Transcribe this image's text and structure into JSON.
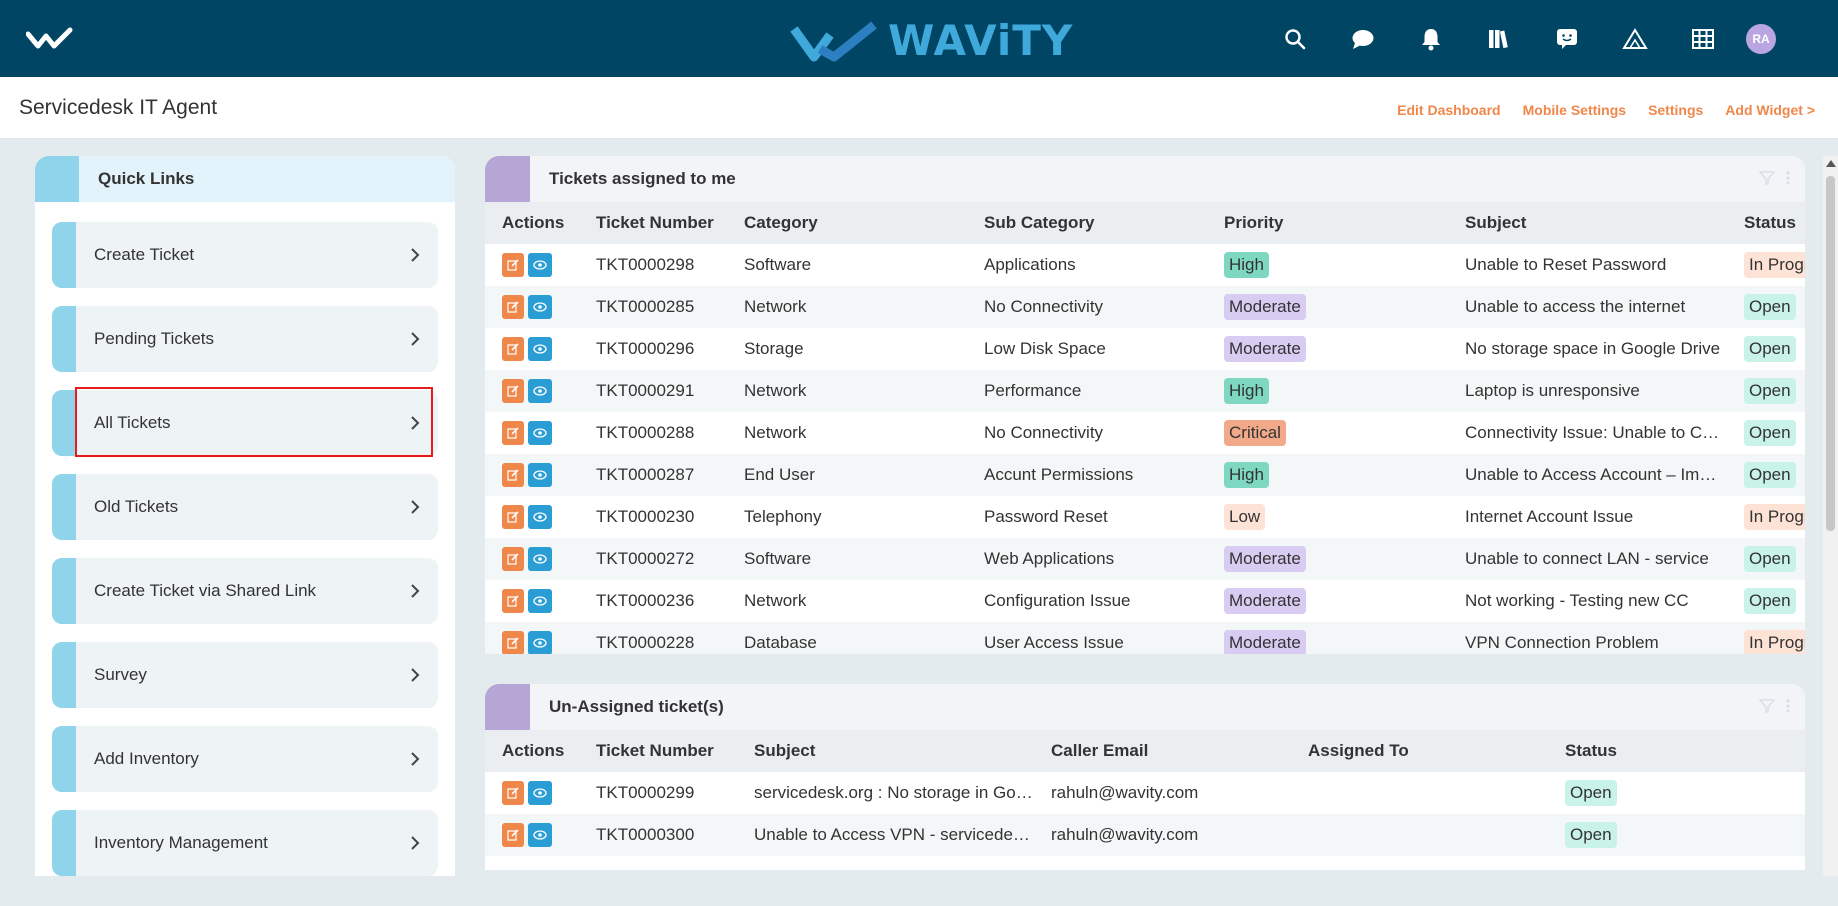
{
  "topbar": {
    "brand": "WAViTY",
    "icons": [
      "search-icon",
      "chat-icon",
      "bell-icon",
      "library-icon",
      "feedback-icon",
      "tent-icon",
      "grid-icon"
    ],
    "avatar": "RA",
    "colors": {
      "background": "#004664",
      "brand": "#3fa9dc"
    }
  },
  "header": {
    "title": "Servicedesk IT Agent",
    "links": [
      "Edit Dashboard",
      "Mobile Settings",
      "Settings",
      "Add Widget >"
    ]
  },
  "quick_links": {
    "title": "Quick Links",
    "items": [
      "Create Ticket",
      "Pending Tickets",
      "All Tickets",
      "Old Tickets",
      "Create Ticket via Shared Link",
      "Survey",
      "Add Inventory",
      "Inventory Management"
    ]
  },
  "assigned": {
    "title": "Tickets assigned to me",
    "columns": [
      "Actions",
      "Ticket Number",
      "Category",
      "Sub Category",
      "Priority",
      "Subject",
      "Status"
    ],
    "rows": [
      {
        "ticket": "TKT0000298",
        "category": "Software",
        "sub": "Applications",
        "priority": "High",
        "subject": "Unable to Reset Password",
        "status": "In Progress"
      },
      {
        "ticket": "TKT0000285",
        "category": "Network",
        "sub": "No Connectivity",
        "priority": "Moderate",
        "subject": "Unable to access the internet",
        "status": "Open"
      },
      {
        "ticket": "TKT0000296",
        "category": "Storage",
        "sub": "Low Disk Space",
        "priority": "Moderate",
        "subject": "No storage space in Google Drive",
        "status": "Open"
      },
      {
        "ticket": "TKT0000291",
        "category": "Network",
        "sub": "Performance",
        "priority": "High",
        "subject": "Laptop is unresponsive",
        "status": "Open"
      },
      {
        "ticket": "TKT0000288",
        "category": "Network",
        "sub": "No Connectivity",
        "priority": "Critical",
        "subject": "Connectivity Issue: Unable to Connect",
        "status": "Open"
      },
      {
        "ticket": "TKT0000287",
        "category": "End User",
        "sub": "Accunt Permissions",
        "priority": "High",
        "subject": "Unable to Access Account – Immediate",
        "status": "Open"
      },
      {
        "ticket": "TKT0000230",
        "category": "Telephony",
        "sub": "Password Reset",
        "priority": "Low",
        "subject": "Internet Account Issue",
        "status": "In Progress"
      },
      {
        "ticket": "TKT0000272",
        "category": "Software",
        "sub": "Web Applications",
        "priority": "Moderate",
        "subject": "Unable to connect LAN - service",
        "status": "Open"
      },
      {
        "ticket": "TKT0000236",
        "category": "Network",
        "sub": "Configuration Issue",
        "priority": "Moderate",
        "subject": "Not working - Testing new CC",
        "status": "Open"
      },
      {
        "ticket": "TKT0000228",
        "category": "Database",
        "sub": "User Access Issue",
        "priority": "Moderate",
        "subject": "VPN Connection Problem",
        "status": "In Progress"
      }
    ]
  },
  "unassigned": {
    "title": "Un-Assigned ticket(s)",
    "columns": [
      "Actions",
      "Ticket Number",
      "Subject",
      "Caller Email",
      "Assigned To",
      "Status"
    ],
    "rows": [
      {
        "ticket": "TKT0000299",
        "subject": "servicedesk.org : No storage in Google Drive",
        "email": "rahuln@wavity.com",
        "assigned": "",
        "status": "Open"
      },
      {
        "ticket": "TKT0000300",
        "subject": "Unable to Access VPN - servicedesk.org",
        "email": "rahuln@wavity.com",
        "assigned": "",
        "status": "Open"
      }
    ]
  }
}
